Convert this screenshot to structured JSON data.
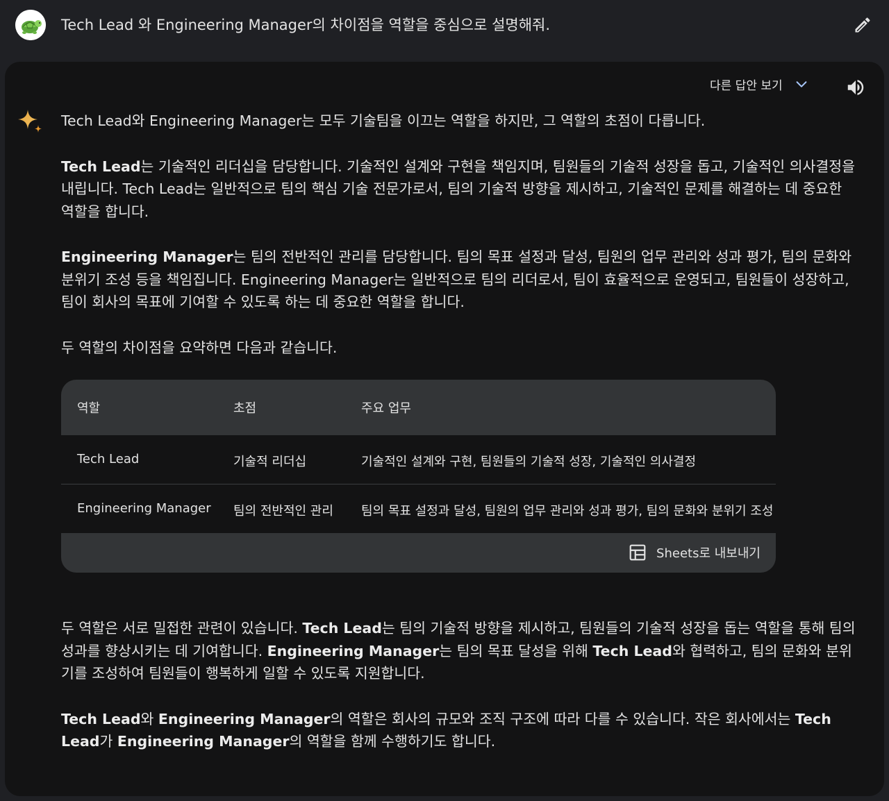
{
  "prompt": {
    "text": "Tech Lead 와 Engineering Manager의 차이점을 역할을 중심으로 설명해줘."
  },
  "response": {
    "drafts_label": "다른 답안 보기",
    "intro": "Tech Lead와 Engineering Manager는 모두 기술팀을 이끄는 역할을 하지만, 그 역할의 초점이 다릅니다.",
    "tl_paragraph": {
      "bold": "Tech Lead",
      "rest": "는 기술적인 리더십을 담당합니다. 기술적인 설계와 구현을 책임지며, 팀원들의 기술적 성장을 돕고, 기술적인 의사결정을 내립니다. Tech Lead는 일반적으로 팀의 핵심 기술 전문가로서, 팀의 기술적 방향을 제시하고, 기술적인 문제를 해결하는 데 중요한 역할을 합니다."
    },
    "em_paragraph": {
      "bold": "Engineering Manager",
      "rest": "는 팀의 전반적인 관리를 담당합니다. 팀의 목표 설정과 달성, 팀원의 업무 관리와 성과 평가, 팀의 문화와 분위기 조성 등을 책임집니다. Engineering Manager는 일반적으로 팀의 리더로서, 팀이 효율적으로 운영되고, 팀원들이 성장하고, 팀이 회사의 목표에 기여할 수 있도록 하는 데 중요한 역할을 합니다."
    },
    "summary_intro": "두 역할의 차이점을 요약하면 다음과 같습니다.",
    "table": {
      "headers": [
        "역할",
        "초점",
        "주요 업무"
      ],
      "rows": [
        [
          "Tech Lead",
          "기술적 리더십",
          "기술적인 설계와 구현, 팀원들의 기술적 성장, 기술적인 의사결정"
        ],
        [
          "Engineering Manager",
          "팀의 전반적인 관리",
          "팀의 목표 설정과 달성, 팀원의 업무 관리와 성과 평가, 팀의 문화와 분위기 조성"
        ]
      ],
      "export_label": "Sheets로 내보내기"
    },
    "relation_paragraph": {
      "p1": "두 역할은 서로 밀접한 관련이 있습니다. ",
      "b1": "Tech Lead",
      "p2": "는 팀의 기술적 방향을 제시하고, 팀원들의 기술적 성장을 돕는 역할을 통해 팀의 성과를 향상시키는 데 기여합니다. ",
      "b2": "Engineering Manager",
      "p3": "는 팀의 목표 달성을 위해 ",
      "b3": "Tech Lead",
      "p4": "와 협력하고, 팀의 문화와 분위기를 조성하여 팀원들이 행복하게 일할 수 있도록 지원합니다."
    },
    "closing_paragraph": {
      "b1": "Tech Lead",
      "p1": "와 ",
      "b2": "Engineering Manager",
      "p2": "의 역할은 회사의 규모와 조직 구조에 따라 다를 수 있습니다. 작은 회사에서는 ",
      "b3": "Tech Lead",
      "p3": "가 ",
      "b4": "Engineering Manager",
      "p4": "의 역할을 함께 수행하기도 합니다."
    }
  },
  "icons": {
    "avatar": "turtle-avatar-icon",
    "edit": "pencil-icon",
    "chevron": "chevron-down-icon",
    "speaker": "speaker-icon",
    "sparkle": "gemini-sparkle-icon",
    "sheets": "table-icon"
  },
  "colors": {
    "page_bg": "#1f2024",
    "card_bg": "#131314",
    "table_header_bg": "#333537",
    "text": "#e3e3e3",
    "accent_blue": "#a8c7fa"
  }
}
